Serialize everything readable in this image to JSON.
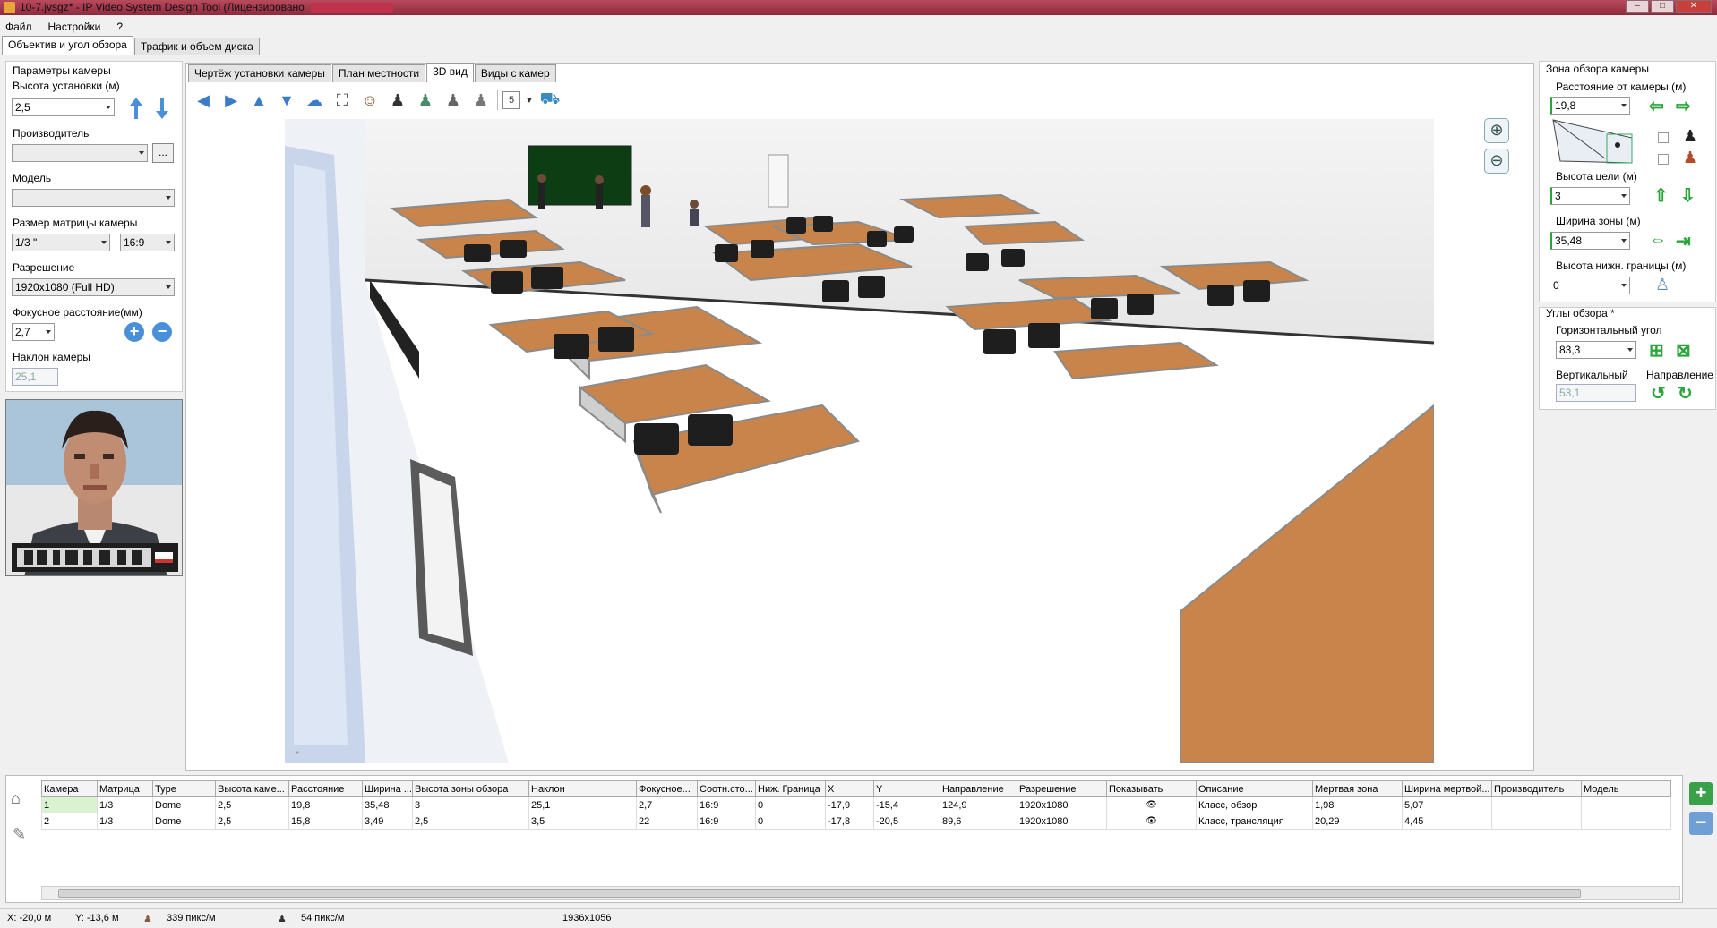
{
  "window": {
    "title": "10-7.jvsgz* - IP Video System Design Tool (Лицензировано"
  },
  "menu": [
    "Файл",
    "Настройки",
    "?"
  ],
  "top_tabs": [
    "Объектив и угол обзора",
    "Трафик и объем диска"
  ],
  "left": {
    "group_title": "Параметры камеры",
    "height_label": "Высота установки (м)",
    "height_value": "2,5",
    "vendor_label": "Производитель",
    "vendor_value": "",
    "vendor_btn": "...",
    "model_label": "Модель",
    "model_value": "",
    "matrix_label": "Размер матрицы камеры",
    "matrix_value": "1/3 \"",
    "aspect_value": "16:9",
    "resolution_label": "Разрешение",
    "resolution_value": "1920x1080 (Full HD)",
    "focal_label": "Фокусное расстояние(мм)",
    "focal_value": "2,7",
    "tilt_label": "Наклон камеры",
    "tilt_value": "25,1"
  },
  "inner_tabs": [
    "Чертёж установки камеры",
    "План местности",
    "3D вид",
    "Виды с камер"
  ],
  "toolbar": {
    "layers_value": "5"
  },
  "right": {
    "zone_title": "Зона обзора камеры",
    "distance_label": "Расстояние от камеры (м)",
    "distance_value": "19,8",
    "target_label": "Высота цели (м)",
    "target_value": "3",
    "width_label": "Ширина зоны (м)",
    "width_value": "35,48",
    "lower_label": "Высота нижн. границы (м)",
    "lower_value": "0",
    "angles_title": "Углы обзора *",
    "h_angle_label": "Горизонтальный угол",
    "h_angle_value": "83,3",
    "v_angle_label": "Вертикальный",
    "v_angle_value": "53,1",
    "direction_label": "Направление"
  },
  "table": {
    "headers": [
      "Камера",
      "Матрица",
      "Type",
      "Высота каме...",
      "Расстояние",
      "Ширина ...",
      "Высота зоны обзора",
      "Наклон",
      "Фокусное...",
      "Соотн.сто...",
      "Ниж. Граница",
      "X",
      "Y",
      "Направление",
      "Разрешение",
      "Показывать",
      "Описание",
      "Мертвая зона",
      "Ширина мертвой...",
      "Производитель",
      "Модель"
    ],
    "rows": [
      [
        "1",
        "1/3",
        "Dome",
        "2,5",
        "19,8",
        "35,48",
        "3",
        "25,1",
        "2,7",
        "16:9",
        "0",
        "-17,9",
        "-15,4",
        "124,9",
        "1920x1080",
        "",
        "Класс, обзор",
        "1,98",
        "5,07",
        "",
        ""
      ],
      [
        "2",
        "1/3",
        "Dome",
        "2,5",
        "15,8",
        "3,49",
        "2,5",
        "3,5",
        "22",
        "16:9",
        "0",
        "-17,8",
        "-20,5",
        "89,6",
        "1920x1080",
        "",
        "Класс, трансляция",
        "20,29",
        "4,45",
        "",
        ""
      ]
    ]
  },
  "status": {
    "x": "X: -20,0 м",
    "y": "Y: -13,6 м",
    "density1": "339 пикс/м",
    "density2": "54 пикс/м",
    "size": "1936x1056"
  }
}
